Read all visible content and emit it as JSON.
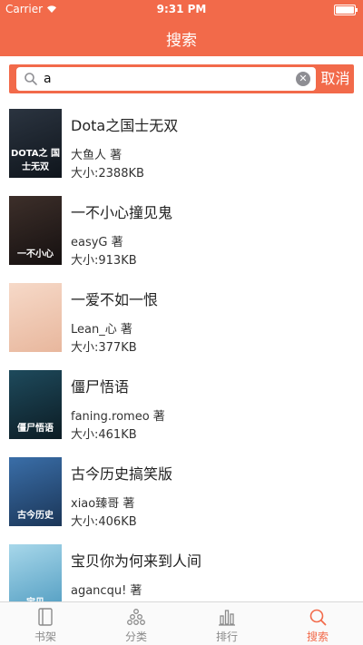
{
  "status_bar": {
    "carrier": "Carrier",
    "time": "9:31 PM"
  },
  "nav": {
    "title": "搜索"
  },
  "search": {
    "value": "a",
    "clear_symbol": "✕",
    "cancel_label": "取消"
  },
  "results": [
    {
      "title": "Dota之国士无双",
      "author": "大鱼人 著",
      "size": "大小:2388KB",
      "cover_text": "DOTA之 国士无双",
      "cover_colors": [
        "#2b3440",
        "#0f151c"
      ]
    },
    {
      "title": "一不小心撞见鬼",
      "author": "easyG 著",
      "size": "大小:913KB",
      "cover_text": "一不小心",
      "cover_colors": [
        "#3d2f2a",
        "#151010"
      ]
    },
    {
      "title": "一爱不如一恨",
      "author": "Lean_心 著",
      "size": "大小:377KB",
      "cover_text": "",
      "cover_colors": [
        "#f6d9c8",
        "#e8b79d"
      ]
    },
    {
      "title": "僵尸悟语",
      "author": "faning.romeo 著",
      "size": "大小:461KB",
      "cover_text": "僵尸悟语",
      "cover_colors": [
        "#1e4a5c",
        "#0c1c24"
      ]
    },
    {
      "title": "古今历史搞笑版",
      "author": "xiao臻哥 著",
      "size": "大小:406KB",
      "cover_text": "古今历史",
      "cover_colors": [
        "#3a6ea8",
        "#1b3658"
      ]
    },
    {
      "title": "宝贝你为何来到人间",
      "author": "agancqu! 著",
      "size": "",
      "cover_text": "宝贝",
      "cover_colors": [
        "#a7d7ea",
        "#4f9bc0"
      ]
    }
  ],
  "tabs": [
    {
      "label": "书架",
      "icon": "book-icon",
      "active": false
    },
    {
      "label": "分类",
      "icon": "category-icon",
      "active": false
    },
    {
      "label": "排行",
      "icon": "chart-icon",
      "active": false
    },
    {
      "label": "搜索",
      "icon": "search-icon",
      "active": true
    }
  ],
  "colors": {
    "accent": "#f26a4a",
    "tab_inactive": "#8a8a8a"
  }
}
